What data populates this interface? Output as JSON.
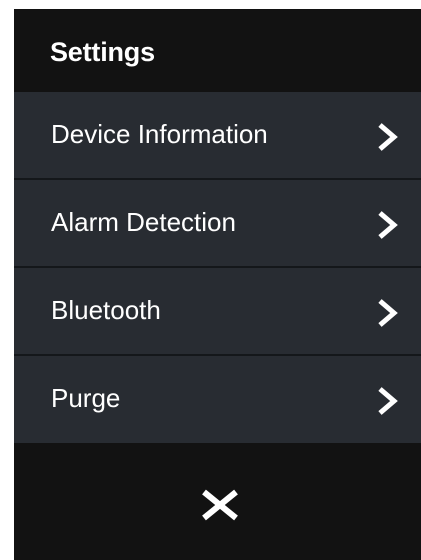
{
  "header": {
    "title": "Settings"
  },
  "menu": {
    "items": [
      {
        "label": "Device Information",
        "icon": "chevron-right-icon"
      },
      {
        "label": "Alarm Detection",
        "icon": "chevron-right-icon"
      },
      {
        "label": "Bluetooth",
        "icon": "chevron-right-icon"
      },
      {
        "label": "Purge",
        "icon": "chevron-right-icon"
      }
    ]
  },
  "footer": {
    "close_icon": "close-icon"
  },
  "colors": {
    "background": "#121212",
    "item_background": "#282c32",
    "divider": "#14171a",
    "text": "#ffffff"
  }
}
